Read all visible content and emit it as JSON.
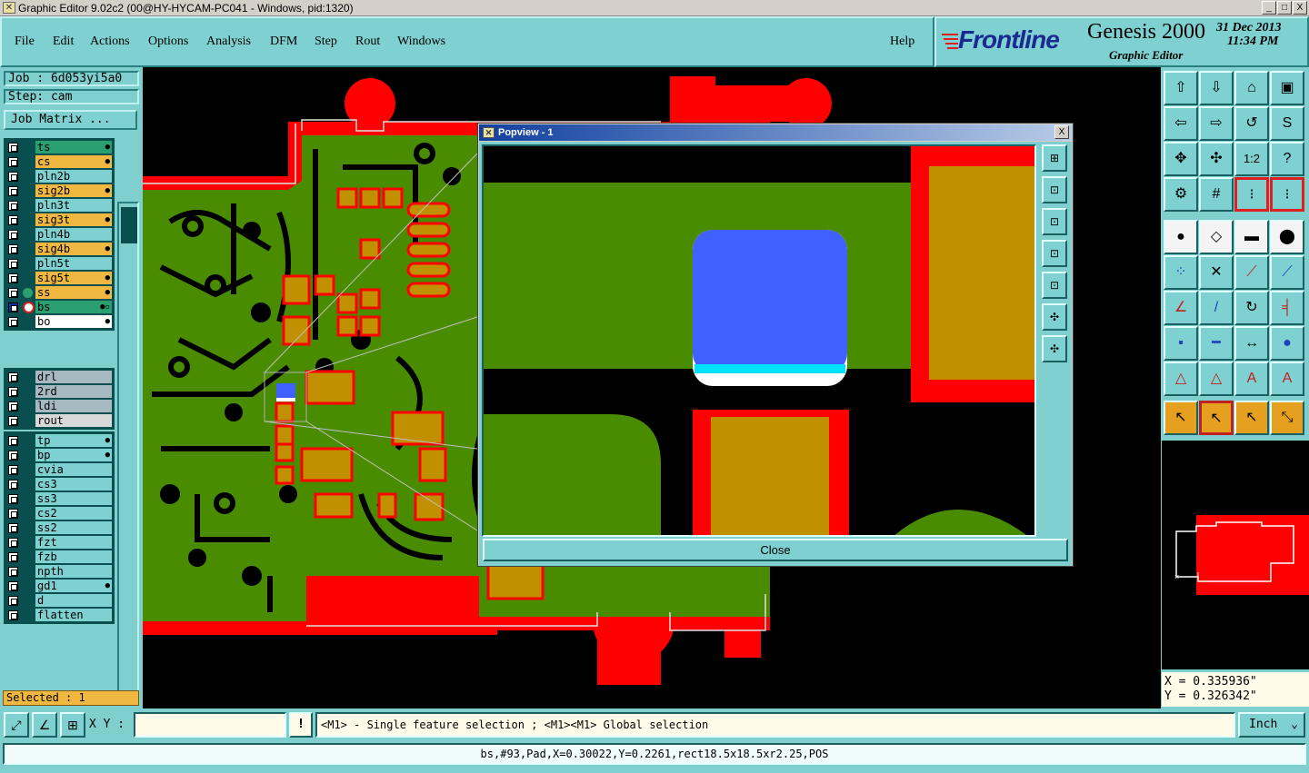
{
  "window": {
    "title": "Graphic Editor 9.02c2 (00@HY-HYCAM-PC041 - Windows, pid:1320)",
    "minimize": "_",
    "maximize": "□",
    "close": "X"
  },
  "menu": [
    "File",
    "Edit",
    "Actions",
    "Options",
    "Analysis",
    "DFM",
    "Step",
    "Rout",
    "Windows"
  ],
  "help_label": "Help",
  "brand": {
    "logo": "Frontline",
    "product": "Genesis 2000",
    "subtitle": "Graphic Editor",
    "date": "31 Dec 2013",
    "time": "11:34 PM"
  },
  "job": {
    "job_label": "Job : 6d053yi5a0",
    "step_label": "Step: cam",
    "matrix_button": "Job Matrix ..."
  },
  "layers_group1": [
    {
      "name": "ts",
      "color": "#2aa070",
      "ind": "●"
    },
    {
      "name": "cs",
      "color": "#f0b840",
      "ind": "●"
    },
    {
      "name": "pln2b",
      "color": "#7fd0d0",
      "ind": ""
    },
    {
      "name": "sig2b",
      "color": "#f0b840",
      "ind": "●"
    },
    {
      "name": "pln3t",
      "color": "#7fd0d0",
      "ind": ""
    },
    {
      "name": "sig3t",
      "color": "#f0b840",
      "ind": "●"
    },
    {
      "name": "pln4b",
      "color": "#7fd0d0",
      "ind": ""
    },
    {
      "name": "sig4b",
      "color": "#f0b840",
      "ind": "●"
    },
    {
      "name": "pln5t",
      "color": "#7fd0d0",
      "ind": ""
    },
    {
      "name": "sig5t",
      "color": "#f0b840",
      "ind": "●"
    },
    {
      "name": "ss",
      "color": "#f0b840",
      "ind": "●"
    },
    {
      "name": "bs",
      "color": "#2aa070",
      "ind": "●▫"
    },
    {
      "name": "bo",
      "color": "#ffffff",
      "ind": "●"
    }
  ],
  "layers_group2": [
    {
      "name": "drl",
      "color": "#a8b8c0",
      "ind": ""
    },
    {
      "name": "2rd",
      "color": "#a8b8c0",
      "ind": ""
    },
    {
      "name": "ldi",
      "color": "#a8b8c0",
      "ind": ""
    },
    {
      "name": "rout",
      "color": "#d8d8d8",
      "ind": ""
    }
  ],
  "layers_group3": [
    {
      "name": "tp",
      "color": "#7fd0d0",
      "ind": "●"
    },
    {
      "name": "bp",
      "color": "#7fd0d0",
      "ind": "●"
    },
    {
      "name": "cvia",
      "color": "#7fd0d0",
      "ind": ""
    },
    {
      "name": "cs3",
      "color": "#7fd0d0",
      "ind": ""
    },
    {
      "name": "ss3",
      "color": "#7fd0d0",
      "ind": ""
    },
    {
      "name": "cs2",
      "color": "#7fd0d0",
      "ind": ""
    },
    {
      "name": "ss2",
      "color": "#7fd0d0",
      "ind": ""
    },
    {
      "name": "fzt",
      "color": "#7fd0d0",
      "ind": ""
    },
    {
      "name": "fzb",
      "color": "#7fd0d0",
      "ind": ""
    },
    {
      "name": "npth",
      "color": "#7fd0d0",
      "ind": ""
    },
    {
      "name": "gd1",
      "color": "#7fd0d0",
      "ind": "●"
    },
    {
      "name": "d",
      "color": "#7fd0d0",
      "ind": ""
    },
    {
      "name": "flatten",
      "color": "#7fd0d0",
      "ind": ""
    }
  ],
  "selected_label": "Selected : 1",
  "popview": {
    "title": "Popview - 1",
    "close_x": "X",
    "close_button": "Close"
  },
  "coords": {
    "x": "X = 0.335936\"",
    "y": "Y = 0.326342\""
  },
  "bottom": {
    "xy_label": "X Y :",
    "xy_value": "",
    "bang": "!",
    "prompt": "<M1> - Single feature selection ; <M1><M1> Global selection",
    "unit": "Inch",
    "status": "bs,#93,Pad,X=0.30022,Y=0.2261,rect18.5x18.5xr2.25,POS"
  },
  "colors": {
    "board_green": "#4a8c00",
    "copper_red": "#ff0000",
    "pad_gold": "#c09000",
    "selected_blue": "#4060ff",
    "panel_cyan": "#7fcfcf"
  }
}
